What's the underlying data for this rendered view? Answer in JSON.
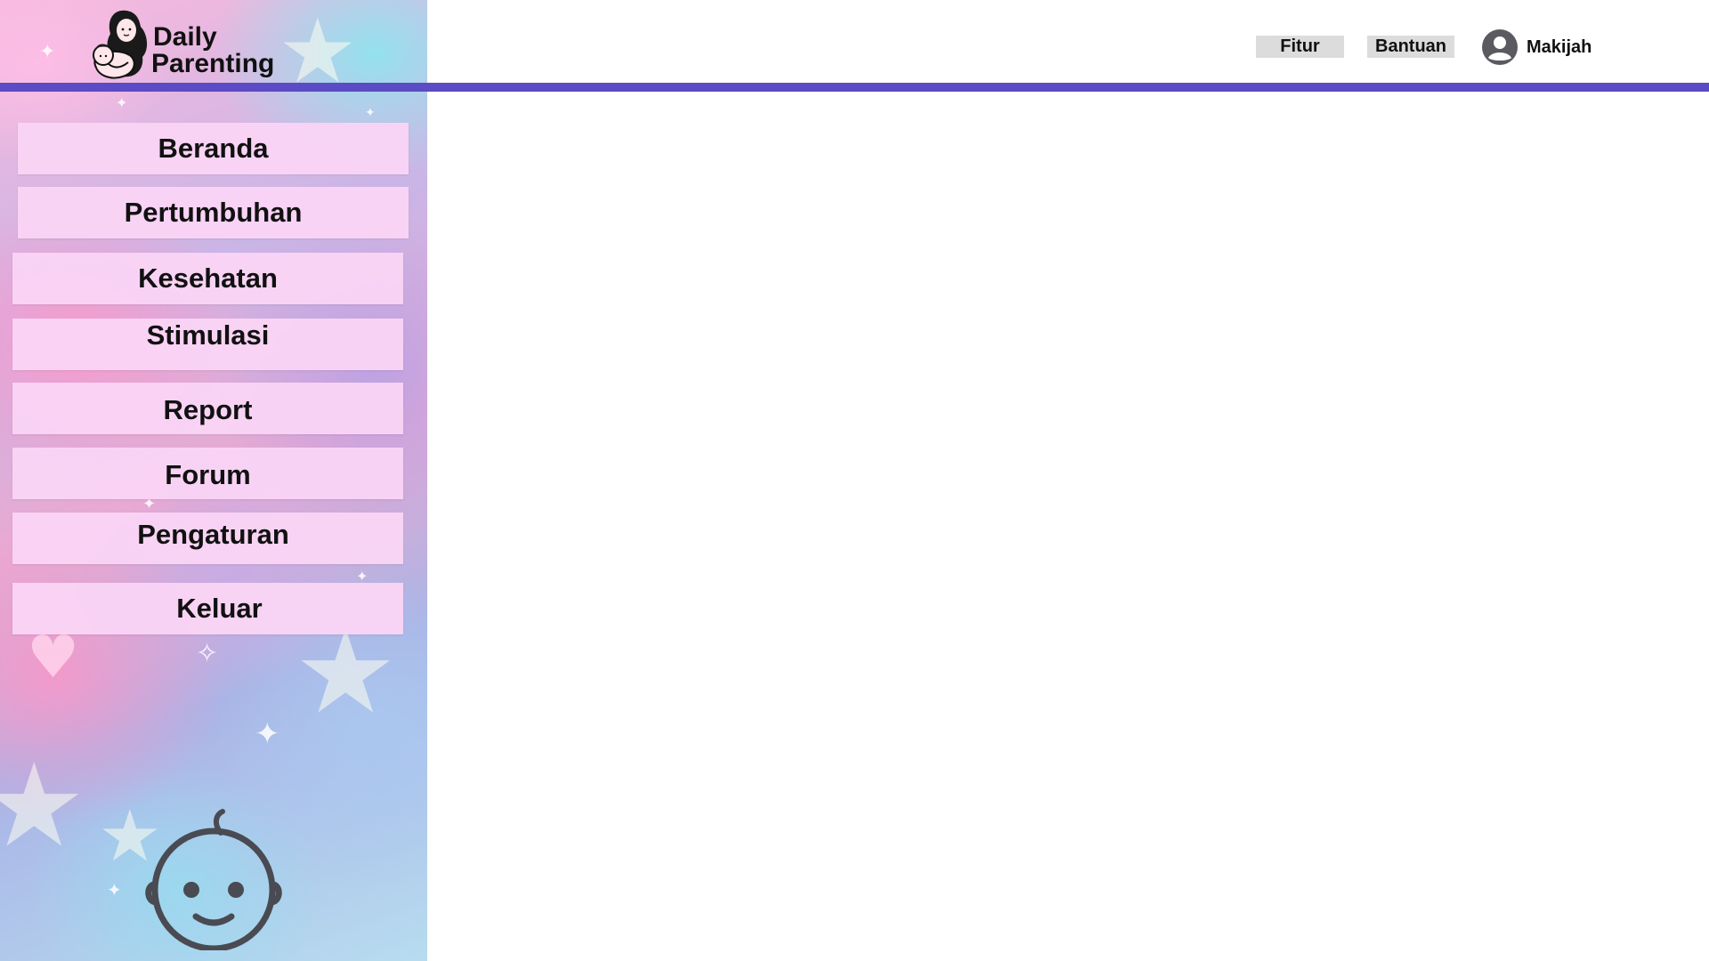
{
  "brand": {
    "line1": "Daily",
    "line2": "Parenting"
  },
  "header": {
    "fitur_label": "Fitur",
    "bantuan_label": "Bantuan",
    "user_name": "Makijah",
    "accent_color": "#5b4bc4"
  },
  "sidebar": {
    "items": [
      {
        "label": "Beranda"
      },
      {
        "label": "Pertumbuhan"
      },
      {
        "label": "Kesehatan"
      },
      {
        "label": "Stimulasi"
      },
      {
        "label": "Report"
      },
      {
        "label": "Forum"
      },
      {
        "label": "Pengaturan"
      },
      {
        "label": "Keluar"
      }
    ],
    "item_color": "#f9d4f5"
  },
  "icons": {
    "logo": "mother-baby-icon",
    "user": "user-avatar-icon",
    "mascot": "baby-face-icon"
  }
}
